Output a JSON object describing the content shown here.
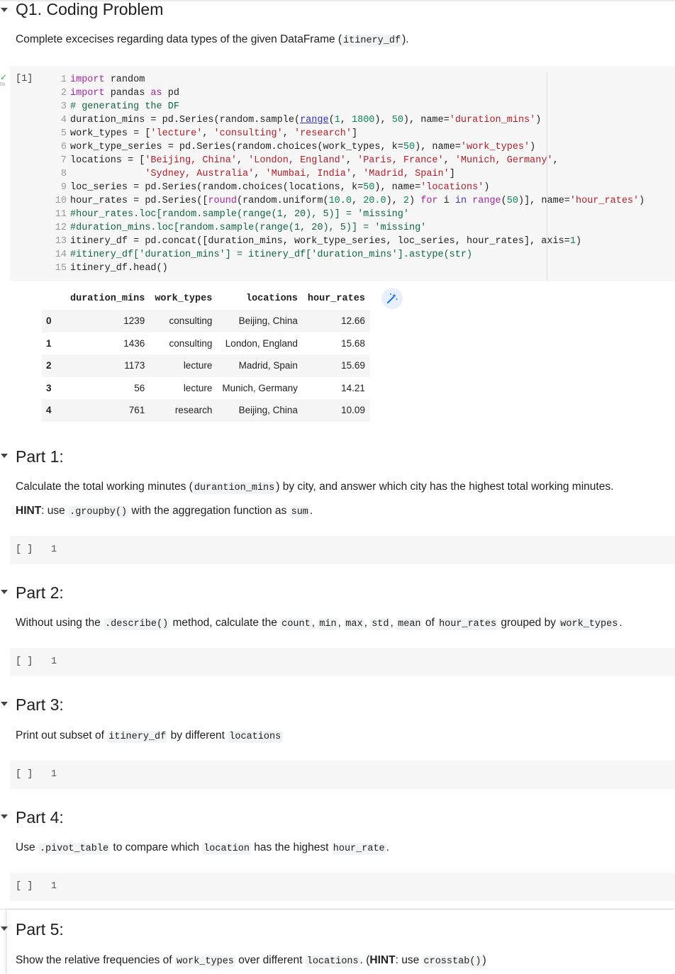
{
  "q1": {
    "title": "Q1. Coding Problem",
    "intro_pre": "Complete excecises regarding data types of the given DataFrame (",
    "intro_code": "itinery_df",
    "intro_post": ")."
  },
  "cell1": {
    "exec_count": "[1]",
    "status_check": "✓",
    "status_time": "0s"
  },
  "table": {
    "headers": [
      "",
      "duration_mins",
      "work_types",
      "locations",
      "hour_rates"
    ],
    "rows": [
      {
        "idx": "0",
        "duration_mins": "1239",
        "work_types": "consulting",
        "locations": "Beijing, China",
        "hour_rates": "12.66"
      },
      {
        "idx": "1",
        "duration_mins": "1436",
        "work_types": "consulting",
        "locations": "London, England",
        "hour_rates": "15.68"
      },
      {
        "idx": "2",
        "duration_mins": "1173",
        "work_types": "lecture",
        "locations": "Madrid, Spain",
        "hour_rates": "15.69"
      },
      {
        "idx": "3",
        "duration_mins": "56",
        "work_types": "lecture",
        "locations": "Munich, Germany",
        "hour_rates": "14.21"
      },
      {
        "idx": "4",
        "duration_mins": "761",
        "work_types": "research",
        "locations": "Beijing, China",
        "hour_rates": "10.09"
      }
    ]
  },
  "part1": {
    "title": "Part 1:",
    "line1_pre": "Calculate the total working minutes (",
    "line1_code": "durantion_mins",
    "line1_post": ") by city, and answer which city has the highest total working minutes.",
    "hint_label": "HINT",
    "hint_pre": ": use ",
    "hint_code1": ".groupby()",
    "hint_mid": " with the aggregation function as ",
    "hint_code2": "sum",
    "hint_post": "."
  },
  "part2": {
    "title": "Part 2:",
    "t1": "Without using the ",
    "c1": ".describe()",
    "t2": " method, calculate the ",
    "c2": "count",
    "t3": ", ",
    "c3": "min",
    "t4": ", ",
    "c4": "max",
    "t5": ", ",
    "c5": "std",
    "t6": ", ",
    "c6": "mean",
    "t7": " of ",
    "c7": "hour_rates",
    "t8": " grouped by ",
    "c8": "work_types",
    "t9": "."
  },
  "part3": {
    "title": "Part 3:",
    "t1": "Print out subset of ",
    "c1": "itinery_df",
    "t2": " by different ",
    "c2": "locations"
  },
  "part4": {
    "title": "Part 4:",
    "t1": "Use ",
    "c1": ".pivot_table",
    "t2": " to compare which ",
    "c2": "location",
    "t3": " has the highest ",
    "c3": "hour_rate",
    "t4": "."
  },
  "part5": {
    "title": "Part 5:",
    "t1": "Show the relative frequencies of ",
    "c1": "work_types",
    "t2": " over different ",
    "c2": "locations",
    "t3": ". (",
    "hint": "HINT",
    "t4": ": use ",
    "c3": "crosstab()",
    "t5": ")"
  },
  "empty_cell": {
    "exec_count": "[ ]",
    "line_number": "1"
  },
  "icons": {
    "collapse": "chevron-down-icon",
    "wand": "magic-wand-icon",
    "status": "check-icon"
  },
  "colors": {
    "keyword": "#a626a4",
    "string": "#b31d28",
    "number": "#098658",
    "comment": "#116644",
    "cell_bg": "#f7f7f7"
  }
}
